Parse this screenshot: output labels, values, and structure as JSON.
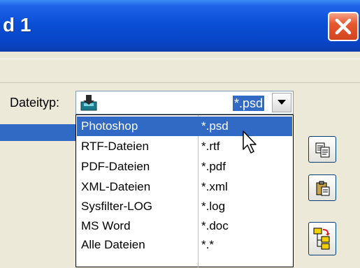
{
  "window": {
    "title": "d 1",
    "close_label": "×"
  },
  "filter": {
    "label": "Dateityp:",
    "selected_value": "*.psd"
  },
  "dropdown": {
    "items": [
      {
        "name": "Photoshop",
        "ext": "*.psd",
        "selected": true
      },
      {
        "name": "RTF-Dateien",
        "ext": "*.rtf",
        "selected": false
      },
      {
        "name": "PDF-Dateien",
        "ext": "*.pdf",
        "selected": false
      },
      {
        "name": "XML-Dateien",
        "ext": "*.xml",
        "selected": false
      },
      {
        "name": "Sysfilter-LOG",
        "ext": "*.log",
        "selected": false
      },
      {
        "name": "MS Word",
        "ext": "*.doc",
        "selected": false
      },
      {
        "name": "Alle Dateien",
        "ext": "*.*",
        "selected": false
      }
    ]
  },
  "toolbar": {
    "buttons": [
      {
        "icon": "copy-icon"
      },
      {
        "icon": "paste-icon"
      },
      {
        "icon": "folder-tree-icon"
      }
    ]
  },
  "colors": {
    "titlebar": "#0845c7",
    "selection": "#316ac5",
    "close": "#d2451f"
  }
}
